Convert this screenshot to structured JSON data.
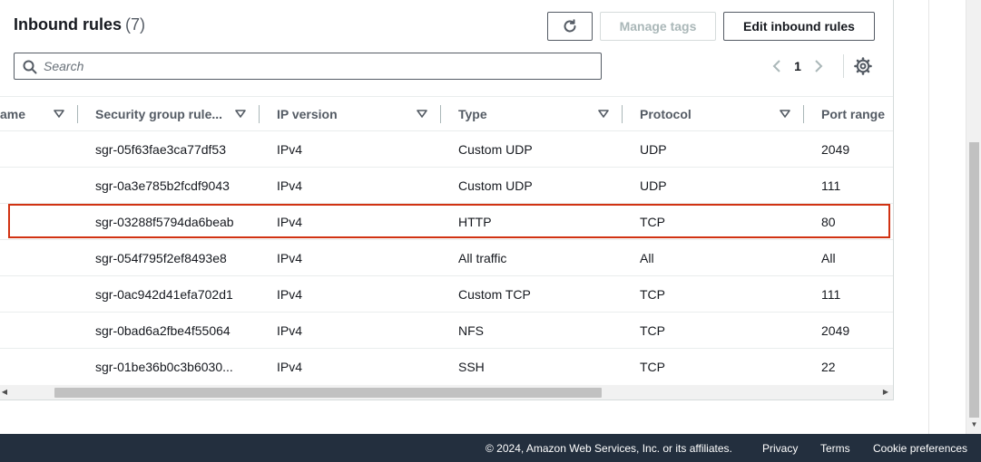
{
  "header": {
    "title": "Inbound rules",
    "count": "(7)"
  },
  "toolbar": {
    "refresh_icon": "refresh-icon",
    "manage_tags_label": "Manage tags",
    "edit_inbound_rules_label": "Edit inbound rules"
  },
  "search": {
    "placeholder": "Search",
    "value": ""
  },
  "pagination": {
    "current_page": "1",
    "prev_icon": "chevron-left-icon",
    "next_icon": "chevron-right-icon",
    "settings_icon": "gear-icon"
  },
  "table": {
    "columns": [
      {
        "label": "ame"
      },
      {
        "label": "Security group rule..."
      },
      {
        "label": "IP version"
      },
      {
        "label": "Type"
      },
      {
        "label": "Protocol"
      },
      {
        "label": "Port range"
      }
    ],
    "rows": [
      {
        "rule_id": "sgr-05f63fae3ca77df53",
        "ip_version": "IPv4",
        "type": "Custom UDP",
        "protocol": "UDP",
        "port_range": "2049"
      },
      {
        "rule_id": "sgr-0a3e785b2fcdf9043",
        "ip_version": "IPv4",
        "type": "Custom UDP",
        "protocol": "UDP",
        "port_range": "111"
      },
      {
        "rule_id": "sgr-03288f5794da6beab",
        "ip_version": "IPv4",
        "type": "HTTP",
        "protocol": "TCP",
        "port_range": "80"
      },
      {
        "rule_id": "sgr-054f795f2ef8493e8",
        "ip_version": "IPv4",
        "type": "All traffic",
        "protocol": "All",
        "port_range": "All"
      },
      {
        "rule_id": "sgr-0ac942d41efa702d1",
        "ip_version": "IPv4",
        "type": "Custom TCP",
        "protocol": "TCP",
        "port_range": "111"
      },
      {
        "rule_id": "sgr-0bad6a2fbe4f55064",
        "ip_version": "IPv4",
        "type": "NFS",
        "protocol": "TCP",
        "port_range": "2049"
      },
      {
        "rule_id": "sgr-01be36b0c3b6030...",
        "ip_version": "IPv4",
        "type": "SSH",
        "protocol": "TCP",
        "port_range": "22"
      }
    ]
  },
  "footer": {
    "copyright": "© 2024, Amazon Web Services, Inc. or its affiliates.",
    "privacy": "Privacy",
    "terms": "Terms",
    "cookie_preferences": "Cookie preferences"
  },
  "colors": {
    "highlight_border": "#d13212",
    "footer_bg": "#232f3e",
    "text_primary": "#16191f",
    "text_secondary": "#545b64"
  }
}
